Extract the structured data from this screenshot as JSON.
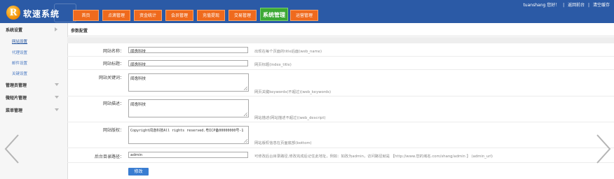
{
  "brand": {
    "logo_letter": "R",
    "name": "软速系统"
  },
  "nav": [
    {
      "label": "首页",
      "active": false
    },
    {
      "label": "点滴管理",
      "active": false
    },
    {
      "label": "资金统计",
      "active": false
    },
    {
      "label": "会员管理",
      "active": false
    },
    {
      "label": "充值提现",
      "active": false
    },
    {
      "label": "交易管理",
      "active": false
    },
    {
      "label": "系统管理",
      "active": true
    },
    {
      "label": "运营管理",
      "active": false
    }
  ],
  "top_links": {
    "user": "tuanshang 您好！",
    "sep1": "|",
    "home": "返回前台",
    "sep2": "|",
    "clear": "清空缓存"
  },
  "sidebar": {
    "groups": [
      {
        "label": "系统设置",
        "expanded": true,
        "items": [
          "网站设置",
          "代理设置",
          "邮件设置",
          "关键设置"
        ]
      },
      {
        "label": "管理员管理",
        "expanded": false,
        "items": []
      },
      {
        "label": "微短片管理",
        "expanded": false,
        "items": []
      },
      {
        "label": "菜单管理",
        "expanded": false,
        "items": []
      }
    ],
    "active_item": "网站设置"
  },
  "breadcrumb": "参数配置",
  "form": {
    "fields": [
      {
        "label": "网站名称：",
        "value": "闻逸科技",
        "hint": "出现在每个页面的title后面(web_name)"
      },
      {
        "label": "网站标题：",
        "value": "闻逸科技",
        "hint": "网页标题(index_title)"
      },
      {
        "label": "网站关键词：",
        "value": "闻逸科技",
        "hint": "网页关键keywords(不超过)(web_keywords)"
      },
      {
        "label": "网站描述：",
        "value": "闻逸科技",
        "hint": "网站描述(网站描述不超过)(web_descript)"
      },
      {
        "label": "网站版权：",
        "value": "Copyright闻逸科技All rights reserved.粤ICP备00000000号-1",
        "hint": "网站版权信息在页面底部(bottom)"
      },
      {
        "label": "后台目录路径：",
        "value": "admin",
        "hint": "可修改后台目录路径,修改完成后记住此地址，例如：如改为admin，访问路径就是 【http://www.您的域名.com/shang/admin 】 (admin_url)"
      }
    ],
    "submit_label": "修改"
  },
  "carousel": {
    "prev_icon": "chevron-left-icon",
    "next_icon": "chevron-right-icon"
  },
  "colors": {
    "topbar": "#2b5aa6",
    "nav": "#ef6a1d",
    "nav_active": "#3da935",
    "button": "#3a7dd1",
    "link": "#4a79c2"
  }
}
